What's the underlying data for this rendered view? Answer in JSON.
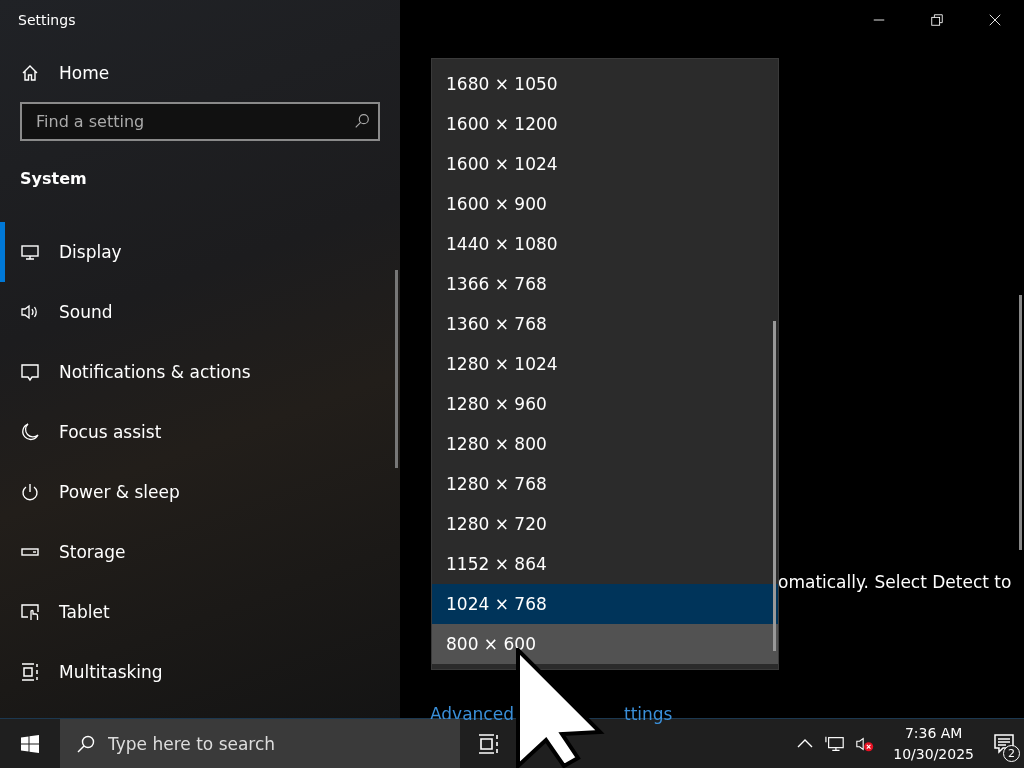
{
  "window": {
    "title": "Settings"
  },
  "sidebar": {
    "home": "Home",
    "search": {
      "placeholder": "Find a setting"
    },
    "section": "System",
    "items": [
      {
        "label": "Display",
        "kind": "display",
        "selected": true
      },
      {
        "label": "Sound",
        "kind": "sound",
        "selected": false
      },
      {
        "label": "Notifications & actions",
        "kind": "notifications",
        "selected": false
      },
      {
        "label": "Focus assist",
        "kind": "focus",
        "selected": false
      },
      {
        "label": "Power & sleep",
        "kind": "power",
        "selected": false
      },
      {
        "label": "Storage",
        "kind": "storage",
        "selected": false
      },
      {
        "label": "Tablet",
        "kind": "tablet",
        "selected": false
      },
      {
        "label": "Multitasking",
        "kind": "multitasking",
        "selected": false
      }
    ]
  },
  "content": {
    "text_fragment": "omatically. Select Detect to",
    "link_fragments": [
      "Advanced",
      "ttings"
    ]
  },
  "dropdown": {
    "options": [
      {
        "label": "1680 × 1050",
        "selected": false,
        "hovered": false
      },
      {
        "label": "1600 × 1200",
        "selected": false,
        "hovered": false
      },
      {
        "label": "1600 × 1024",
        "selected": false,
        "hovered": false
      },
      {
        "label": "1600 × 900",
        "selected": false,
        "hovered": false
      },
      {
        "label": "1440 × 1080",
        "selected": false,
        "hovered": false
      },
      {
        "label": "1366 × 768",
        "selected": false,
        "hovered": false
      },
      {
        "label": "1360 × 768",
        "selected": false,
        "hovered": false
      },
      {
        "label": "1280 × 1024",
        "selected": false,
        "hovered": false
      },
      {
        "label": "1280 × 960",
        "selected": false,
        "hovered": false
      },
      {
        "label": "1280 × 800",
        "selected": false,
        "hovered": false
      },
      {
        "label": "1280 × 768",
        "selected": false,
        "hovered": false
      },
      {
        "label": "1280 × 720",
        "selected": false,
        "hovered": false
      },
      {
        "label": "1152 × 864",
        "selected": false,
        "hovered": false
      },
      {
        "label": "1024 × 768",
        "selected": true,
        "hovered": false
      },
      {
        "label": "800 × 600",
        "selected": false,
        "hovered": true
      }
    ]
  },
  "taskbar": {
    "search": {
      "placeholder": "Type here to search"
    },
    "time": "7:36 AM",
    "date": "10/30/2025",
    "notification_count": "2"
  }
}
